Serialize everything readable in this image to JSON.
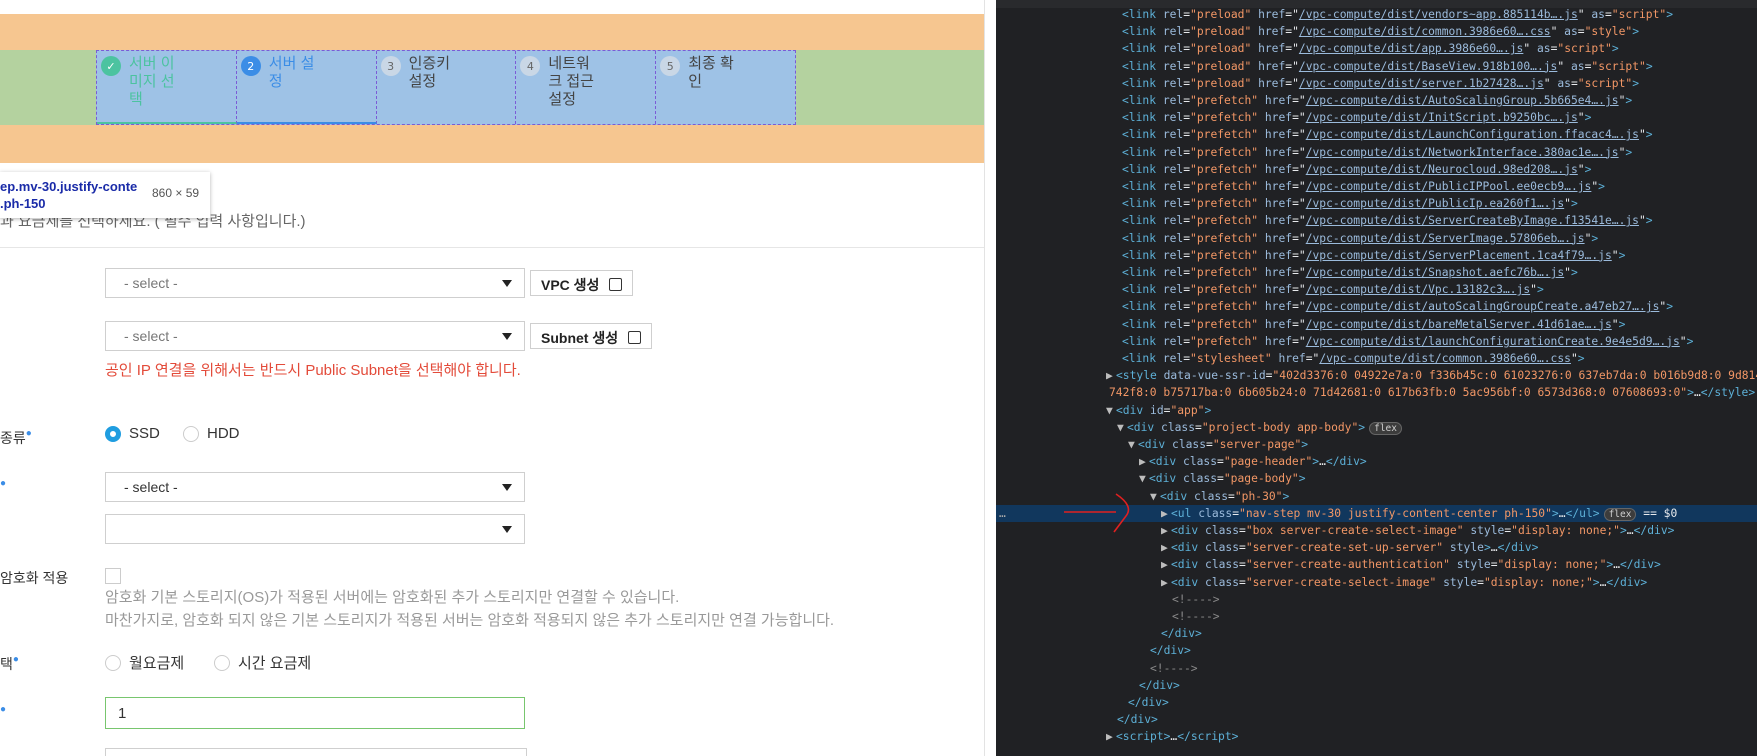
{
  "steps": [
    {
      "num": "✓",
      "label": "서버 이\n미지 선\n택",
      "state": "done"
    },
    {
      "num": "2",
      "label": "서버 설\n정",
      "state": "active"
    },
    {
      "num": "3",
      "label": "인증키\n설정",
      "state": "todo"
    },
    {
      "num": "4",
      "label": "네트워\n크 접근\n설정",
      "state": "todo"
    },
    {
      "num": "5",
      "label": "최종 확\n인",
      "state": "todo"
    }
  ],
  "tooltip": {
    "selector": "ep.mv-30.justify-conte\n.ph-150",
    "size": "860 × 59"
  },
  "description": "과 요금제를 선택하세요. ( 필수 입력 사항입니다.)",
  "form": {
    "vpc_select": "- select -",
    "vpc_button": "VPC 생성",
    "subnet_select": "- select -",
    "subnet_button": "Subnet 생성",
    "subnet_error": "공인 IP 연결을 위해서는 반드시 Public Subnet을 선택해야 합니다.",
    "storage_label": "종류",
    "storage_ssd": "SSD",
    "storage_hdd": "HDD",
    "spec_select": "- select -",
    "spec_select2": "",
    "encrypt_label": "암호화 적용",
    "encrypt_note1": "암호화 기본 스토리지(OS)가 적용된 서버에는 암호화된 추가 스토리지만 연결할 수 있습니다.",
    "encrypt_note2": "마찬가지로, 암호화 되지 않은 기본 스토리지가 적용된 서버는 암호화 적용되지 않은 추가 스토리지만 연결 가능합니다.",
    "billing_label": "택",
    "billing_monthly": "월요금제",
    "billing_hourly": "시간 요금제",
    "count_value": "1"
  },
  "devtools": {
    "lines": [
      {
        "indent": 126,
        "html": "<span class='tag'>&lt;link</span> <span class='attr'>rel</span>=<span class='val'>\"preload\"</span> <span class='attr'>href</span>=\"<span class='link'>/vpc-compute/dist/vendors~app.885114b….js</span>\" <span class='attr'>as</span>=<span class='val'>\"script\"</span><span class='tag'>&gt;</span>"
      },
      {
        "indent": 126,
        "html": "<span class='tag'>&lt;link</span> <span class='attr'>rel</span>=<span class='val'>\"preload\"</span> <span class='attr'>href</span>=\"<span class='link'>/vpc-compute/dist/common.3986e60….css</span>\" <span class='attr'>as</span>=<span class='val'>\"style\"</span><span class='tag'>&gt;</span>"
      },
      {
        "indent": 126,
        "html": "<span class='tag'>&lt;link</span> <span class='attr'>rel</span>=<span class='val'>\"preload\"</span> <span class='attr'>href</span>=\"<span class='link'>/vpc-compute/dist/app.3986e60….js</span>\" <span class='attr'>as</span>=<span class='val'>\"script\"</span><span class='tag'>&gt;</span>"
      },
      {
        "indent": 126,
        "html": "<span class='tag'>&lt;link</span> <span class='attr'>rel</span>=<span class='val'>\"preload\"</span> <span class='attr'>href</span>=\"<span class='link'>/vpc-compute/dist/BaseView.918b100….js</span>\" <span class='attr'>as</span>=<span class='val'>\"script\"</span><span class='tag'>&gt;</span>"
      },
      {
        "indent": 126,
        "html": "<span class='tag'>&lt;link</span> <span class='attr'>rel</span>=<span class='val'>\"preload\"</span> <span class='attr'>href</span>=\"<span class='link'>/vpc-compute/dist/server.1b27428….js</span>\" <span class='attr'>as</span>=<span class='val'>\"script\"</span><span class='tag'>&gt;</span>"
      },
      {
        "indent": 126,
        "html": "<span class='tag'>&lt;link</span> <span class='attr'>rel</span>=<span class='val'>\"prefetch\"</span> <span class='attr'>href</span>=\"<span class='link'>/vpc-compute/dist/AutoScalingGroup.5b665e4….js</span>\"<span class='tag'>&gt;</span>"
      },
      {
        "indent": 126,
        "html": "<span class='tag'>&lt;link</span> <span class='attr'>rel</span>=<span class='val'>\"prefetch\"</span> <span class='attr'>href</span>=\"<span class='link'>/vpc-compute/dist/InitScript.b9250bc….js</span>\"<span class='tag'>&gt;</span>"
      },
      {
        "indent": 126,
        "html": "<span class='tag'>&lt;link</span> <span class='attr'>rel</span>=<span class='val'>\"prefetch\"</span> <span class='attr'>href</span>=\"<span class='link'>/vpc-compute/dist/LaunchConfiguration.ffacac4….js</span>\"<span class='tag'>&gt;</span>"
      },
      {
        "indent": 126,
        "html": "<span class='tag'>&lt;link</span> <span class='attr'>rel</span>=<span class='val'>\"prefetch\"</span> <span class='attr'>href</span>=\"<span class='link'>/vpc-compute/dist/NetworkInterface.380ac1e….js</span>\"<span class='tag'>&gt;</span>"
      },
      {
        "indent": 126,
        "html": "<span class='tag'>&lt;link</span> <span class='attr'>rel</span>=<span class='val'>\"prefetch\"</span> <span class='attr'>href</span>=\"<span class='link'>/vpc-compute/dist/Neurocloud.98ed208….js</span>\"<span class='tag'>&gt;</span>"
      },
      {
        "indent": 126,
        "html": "<span class='tag'>&lt;link</span> <span class='attr'>rel</span>=<span class='val'>\"prefetch\"</span> <span class='attr'>href</span>=\"<span class='link'>/vpc-compute/dist/PublicIPPool.ee0ecb9….js</span>\"<span class='tag'>&gt;</span>"
      },
      {
        "indent": 126,
        "html": "<span class='tag'>&lt;link</span> <span class='attr'>rel</span>=<span class='val'>\"prefetch\"</span> <span class='attr'>href</span>=\"<span class='link'>/vpc-compute/dist/PublicIp.ea260f1….js</span>\"<span class='tag'>&gt;</span>"
      },
      {
        "indent": 126,
        "html": "<span class='tag'>&lt;link</span> <span class='attr'>rel</span>=<span class='val'>\"prefetch\"</span> <span class='attr'>href</span>=\"<span class='link'>/vpc-compute/dist/ServerCreateByImage.f13541e….js</span>\"<span class='tag'>&gt;</span>"
      },
      {
        "indent": 126,
        "html": "<span class='tag'>&lt;link</span> <span class='attr'>rel</span>=<span class='val'>\"prefetch\"</span> <span class='attr'>href</span>=\"<span class='link'>/vpc-compute/dist/ServerImage.57806eb….js</span>\"<span class='tag'>&gt;</span>"
      },
      {
        "indent": 126,
        "html": "<span class='tag'>&lt;link</span> <span class='attr'>rel</span>=<span class='val'>\"prefetch\"</span> <span class='attr'>href</span>=\"<span class='link'>/vpc-compute/dist/ServerPlacement.1ca4f79….js</span>\"<span class='tag'>&gt;</span>"
      },
      {
        "indent": 126,
        "html": "<span class='tag'>&lt;link</span> <span class='attr'>rel</span>=<span class='val'>\"prefetch\"</span> <span class='attr'>href</span>=\"<span class='link'>/vpc-compute/dist/Snapshot.aefc76b….js</span>\"<span class='tag'>&gt;</span>"
      },
      {
        "indent": 126,
        "html": "<span class='tag'>&lt;link</span> <span class='attr'>rel</span>=<span class='val'>\"prefetch\"</span> <span class='attr'>href</span>=\"<span class='link'>/vpc-compute/dist/Vpc.13182c3….js</span>\"<span class='tag'>&gt;</span>"
      },
      {
        "indent": 126,
        "html": "<span class='tag'>&lt;link</span> <span class='attr'>rel</span>=<span class='val'>\"prefetch\"</span> <span class='attr'>href</span>=\"<span class='link'>/vpc-compute/dist/autoScalingGroupCreate.a47eb27….js</span>\"<span class='tag'>&gt;</span>"
      },
      {
        "indent": 126,
        "html": "<span class='tag'>&lt;link</span> <span class='attr'>rel</span>=<span class='val'>\"prefetch\"</span> <span class='attr'>href</span>=\"<span class='link'>/vpc-compute/dist/bareMetalServer.41d61ae….js</span>\"<span class='tag'>&gt;</span>"
      },
      {
        "indent": 126,
        "html": "<span class='tag'>&lt;link</span> <span class='attr'>rel</span>=<span class='val'>\"prefetch\"</span> <span class='attr'>href</span>=\"<span class='link'>/vpc-compute/dist/launchConfigurationCreate.9e4e5d9….js</span>\"<span class='tag'>&gt;</span>"
      },
      {
        "indent": 126,
        "html": "<span class='tag'>&lt;link</span> <span class='attr'>rel</span>=<span class='val'>\"stylesheet\"</span> <span class='attr'>href</span>=\"<span class='link'>/vpc-compute/dist/common.3986e60….css</span>\"<span class='tag'>&gt;</span>"
      },
      {
        "indent": 110,
        "html": "<span class='tri'>▶</span><span class='tag'>&lt;style</span> <span class='attr'>data-vue-ssr-id</span>=<span class='val'>\"402d3376:0 04922e7a:0 f336b45c:0 61023276:0 637eb7da:0 b016b9d8:0 9d814</span>"
      },
      {
        "indent": 113,
        "html": "<span class='val'>742f8:0 b75717ba:0 6b605b24:0 71d42681:0 617b63fb:0 5ac956bf:0 6573d368:0 07608693:0\"</span><span class='tag'>&gt;</span><span class='txt'>…</span><span class='tag'>&lt;/style&gt;</span>"
      },
      {
        "indent": 110,
        "html": "<span class='tri'>▼</span><span class='tag'>&lt;div</span> <span class='attr'>id</span>=<span class='val'>\"app\"</span><span class='tag'>&gt;</span>"
      },
      {
        "indent": 121,
        "html": "<span class='tri'>▼</span><span class='tag'>&lt;div</span> <span class='attr'>class</span>=<span class='val'>\"project-body app-body\"</span><span class='tag'>&gt;</span><span class='badge'>flex</span>"
      },
      {
        "indent": 132,
        "html": "<span class='tri'>▼</span><span class='tag'>&lt;div</span> <span class='attr'>class</span>=<span class='val'>\"server-page\"</span><span class='tag'>&gt;</span>"
      },
      {
        "indent": 143,
        "html": "<span class='tri'>▶</span><span class='tag'>&lt;div</span> <span class='attr'>class</span>=<span class='val'>\"page-header\"</span><span class='tag'>&gt;</span><span class='txt'>…</span><span class='tag'>&lt;/div&gt;</span>"
      },
      {
        "indent": 143,
        "html": "<span class='tri'>▼</span><span class='tag'>&lt;div</span> <span class='attr'>class</span>=<span class='val'>\"page-body\"</span><span class='tag'>&gt;</span>"
      },
      {
        "indent": 154,
        "html": "<span class='tri'>▼</span><span class='tag'>&lt;div</span> <span class='attr'>class</span>=<span class='val'>\"ph-30\"</span><span class='tag'>&gt;</span>"
      },
      {
        "indent": 165,
        "sel": true,
        "html": "<span class='tri'>▶</span><span class='tag'>&lt;ul</span> <span class='attr'>class</span>=<span class='val'>\"nav-step mv-30 justify-content-center ph-150\"</span><span class='tag'>&gt;</span><span class='txt'>…</span><span class='tag'>&lt;/ul&gt;</span><span class='badge'>flex</span> <span class='txt'>== $0</span>"
      },
      {
        "indent": 165,
        "html": "<span class='tri'>▶</span><span class='tag'>&lt;div</span> <span class='attr'>class</span>=<span class='val'>\"box server-create-select-image\"</span> <span class='attr'>style</span>=<span class='val'>\"display: none;\"</span><span class='tag'>&gt;</span><span class='txt'>…</span><span class='tag'>&lt;/div&gt;</span>"
      },
      {
        "indent": 165,
        "html": "<span class='tri'>▶</span><span class='tag'>&lt;div</span> <span class='attr'>class</span>=<span class='val'>\"server-create-set-up-server\"</span> <span class='attr'>style</span><span class='tag'>&gt;</span><span class='txt'>…</span><span class='tag'>&lt;/div&gt;</span>"
      },
      {
        "indent": 165,
        "html": "<span class='tri'>▶</span><span class='tag'>&lt;div</span> <span class='attr'>class</span>=<span class='val'>\"server-create-authentication\"</span> <span class='attr'>style</span>=<span class='val'>\"display: none;\"</span><span class='tag'>&gt;</span><span class='txt'>…</span><span class='tag'>&lt;/div&gt;</span>"
      },
      {
        "indent": 165,
        "html": "<span class='tri'>▶</span><span class='tag'>&lt;div</span> <span class='attr'>class</span>=<span class='val'>\"server-create-select-image\"</span> <span class='attr'>style</span>=<span class='val'>\"display: none;\"</span><span class='tag'>&gt;</span><span class='txt'>…</span><span class='tag'>&lt;/div&gt;</span>"
      },
      {
        "indent": 176,
        "html": "<span class='cmt'>&lt;!----&gt;</span>"
      },
      {
        "indent": 176,
        "html": "<span class='cmt'>&lt;!----&gt;</span>"
      },
      {
        "indent": 165,
        "html": "<span class='tag'>&lt;/div&gt;</span>"
      },
      {
        "indent": 154,
        "html": "<span class='tag'>&lt;/div&gt;</span>"
      },
      {
        "indent": 154,
        "html": "<span class='cmt'>&lt;!----&gt;</span>"
      },
      {
        "indent": 143,
        "html": "<span class='tag'>&lt;/div&gt;</span>"
      },
      {
        "indent": 132,
        "html": "<span class='tag'>&lt;/div&gt;</span>"
      },
      {
        "indent": 121,
        "html": "<span class='tag'>&lt;/div&gt;</span>"
      },
      {
        "indent": 110,
        "html": "<span class='tri'>▶</span><span class='tag'>&lt;script&gt;</span><span class='txt'>…</span><span class='tag'>&lt;/script&gt;</span>"
      }
    ]
  }
}
